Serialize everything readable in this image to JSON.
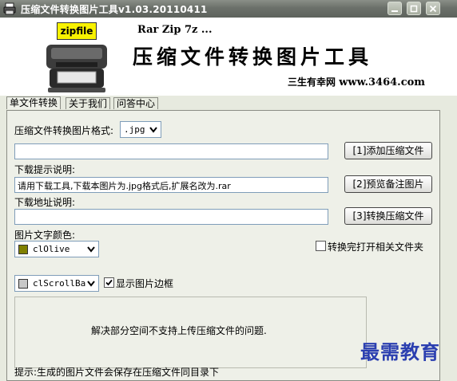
{
  "window": {
    "title": "压缩文件转换图片工具v1.03.20110411"
  },
  "banner": {
    "badge": "zipfile",
    "tagline": "Rar Zip 7z ...",
    "big_title": "压缩文件转换图片工具",
    "site_cn": "三生有幸网",
    "site_url": "www.3464.com"
  },
  "tabs": [
    "单文件转换",
    "关于我们",
    "问答中心"
  ],
  "form": {
    "format_label": "压缩文件转换图片格式:",
    "format_value": ".jpg",
    "file_path_value": "",
    "add_button": "[1]添加压缩文件",
    "download_hint_label": "下载提示说明:",
    "download_hint_value": "请用下载工具,下载本图片为.jpg格式后,扩展名改为.rar",
    "preview_button": "[2]预览备注图片",
    "download_url_label": "下载地址说明:",
    "download_url_value": "",
    "convert_button": "[3]转换压缩文件",
    "text_color_label": "图片文字颜色:",
    "text_color_value": "clOlive",
    "text_color_hex": "#808000",
    "open_folder_label": "转换完打开相关文件夹",
    "open_folder_checked": false,
    "border_color_value": "clScrollBar",
    "border_color_hex": "#c8c8c8",
    "show_border_label": "显示图片边框",
    "show_border_checked": true
  },
  "preview": {
    "text": "解决部分空间不支持上传压缩文件的问题."
  },
  "status": {
    "hint": "提示:生成的图片文件会保存在压缩文件同目录下"
  },
  "watermark": "最需教育"
}
